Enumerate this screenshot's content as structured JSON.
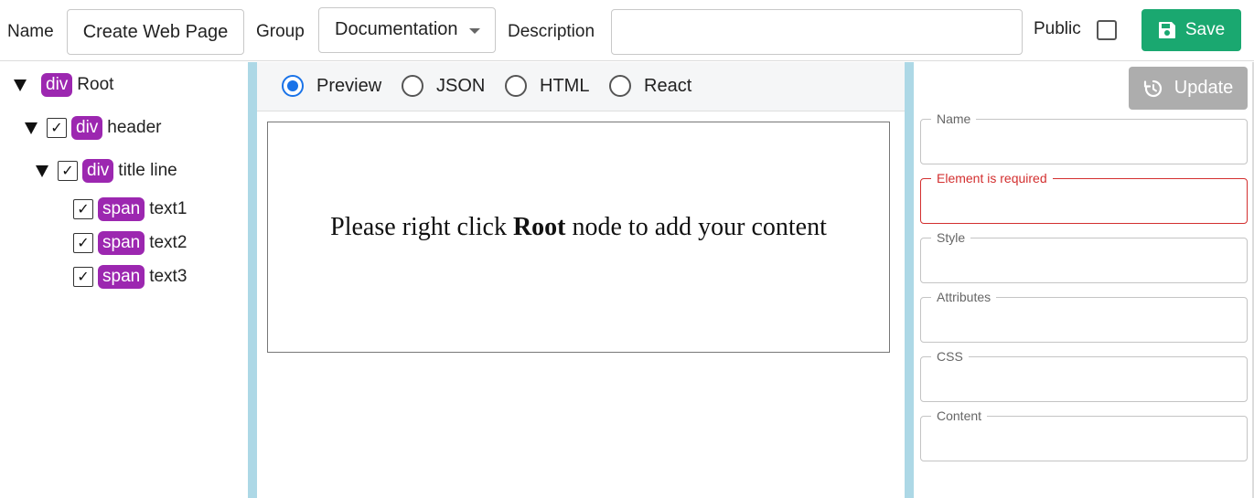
{
  "toolbar": {
    "name_label": "Name",
    "name_value": "Create Web Page",
    "group_label": "Group",
    "group_value": "Documentation",
    "description_label": "Description",
    "description_value": "",
    "public_label": "Public",
    "public_checked": false,
    "save_label": "Save"
  },
  "tree": {
    "nodes": [
      {
        "tag": "div",
        "label": "Root",
        "expanded": true,
        "checked": null
      },
      {
        "tag": "div",
        "label": "header",
        "expanded": true,
        "checked": true
      },
      {
        "tag": "div",
        "label": "title line",
        "expanded": true,
        "checked": true
      },
      {
        "tag": "span",
        "label": "text1",
        "checked": true
      },
      {
        "tag": "span",
        "label": "text2",
        "checked": true
      },
      {
        "tag": "span",
        "label": "text3",
        "checked": true
      }
    ]
  },
  "view_tabs": {
    "options": [
      "Preview",
      "JSON",
      "HTML",
      "React"
    ],
    "selected": "Preview"
  },
  "preview": {
    "text_before": "Please right click ",
    "text_bold": "Root",
    "text_after": " node to add your content"
  },
  "properties": {
    "update_label": "Update",
    "fields": [
      {
        "label": "Name",
        "value": "",
        "error": false
      },
      {
        "label": "Element is required",
        "value": "",
        "error": true
      },
      {
        "label": "Style",
        "value": "",
        "error": false
      },
      {
        "label": "Attributes",
        "value": "",
        "error": false
      },
      {
        "label": "CSS",
        "value": "",
        "error": false
      },
      {
        "label": "Content",
        "value": "",
        "error": false
      }
    ]
  },
  "colors": {
    "save_button": "#1aa870",
    "update_button": "#adadad",
    "tag_badge": "#9c27b0",
    "divider": "#add8e6",
    "radio_selected": "#1a73e8",
    "error": "#d32f2f"
  }
}
